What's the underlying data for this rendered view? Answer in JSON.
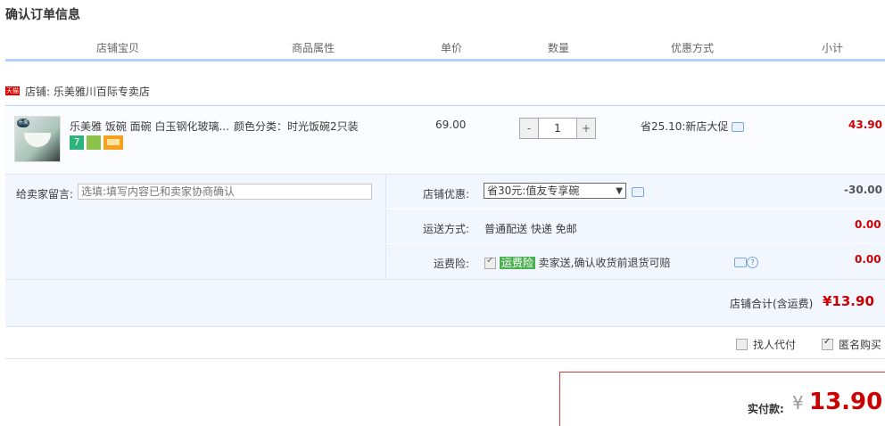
{
  "title": "确认订单信息",
  "headers": [
    "店铺宝贝",
    "商品属性",
    "单价",
    "数量",
    "优惠方式",
    "小计"
  ],
  "shop": {
    "badge": "天猫",
    "label": "店铺: 乐美雅川百际专卖店"
  },
  "item": {
    "thumb_badge": "乐美",
    "name": "乐美雅 饭碗 面碗 白玉钢化玻璃...",
    "attr": "颜色分类：时光饭碗2只装",
    "price": "69.00",
    "qty_minus": "-",
    "qty": "1",
    "qty_plus": "+",
    "promo": "省25.10:新店大促",
    "subtotal": "43.90",
    "icon_7_label": "7"
  },
  "message": {
    "label": "给卖家留言:",
    "placeholder": "选填:填写内容已和卖家协商确认"
  },
  "shop_discount": {
    "label": "店铺优惠:",
    "selected": "省30元:值友专享碗",
    "arrow": "▼",
    "value": "-30.00"
  },
  "shipping": {
    "label": "运送方式:",
    "value": "普通配送 快递 免邮",
    "amount": "0.00"
  },
  "insurance": {
    "label": "运费险:",
    "tag": "运费险",
    "text": "卖家送,确认收货前退货可赔",
    "amount": "0.00",
    "help": "?"
  },
  "shop_total": {
    "label": "店铺合计(含运费)",
    "value": "¥13.90"
  },
  "footer_options": {
    "proxy_pay": "找人代付",
    "anonymous": "匿名购买"
  },
  "payment": {
    "label": "实付款:",
    "currency": "¥",
    "value": "13.90"
  }
}
